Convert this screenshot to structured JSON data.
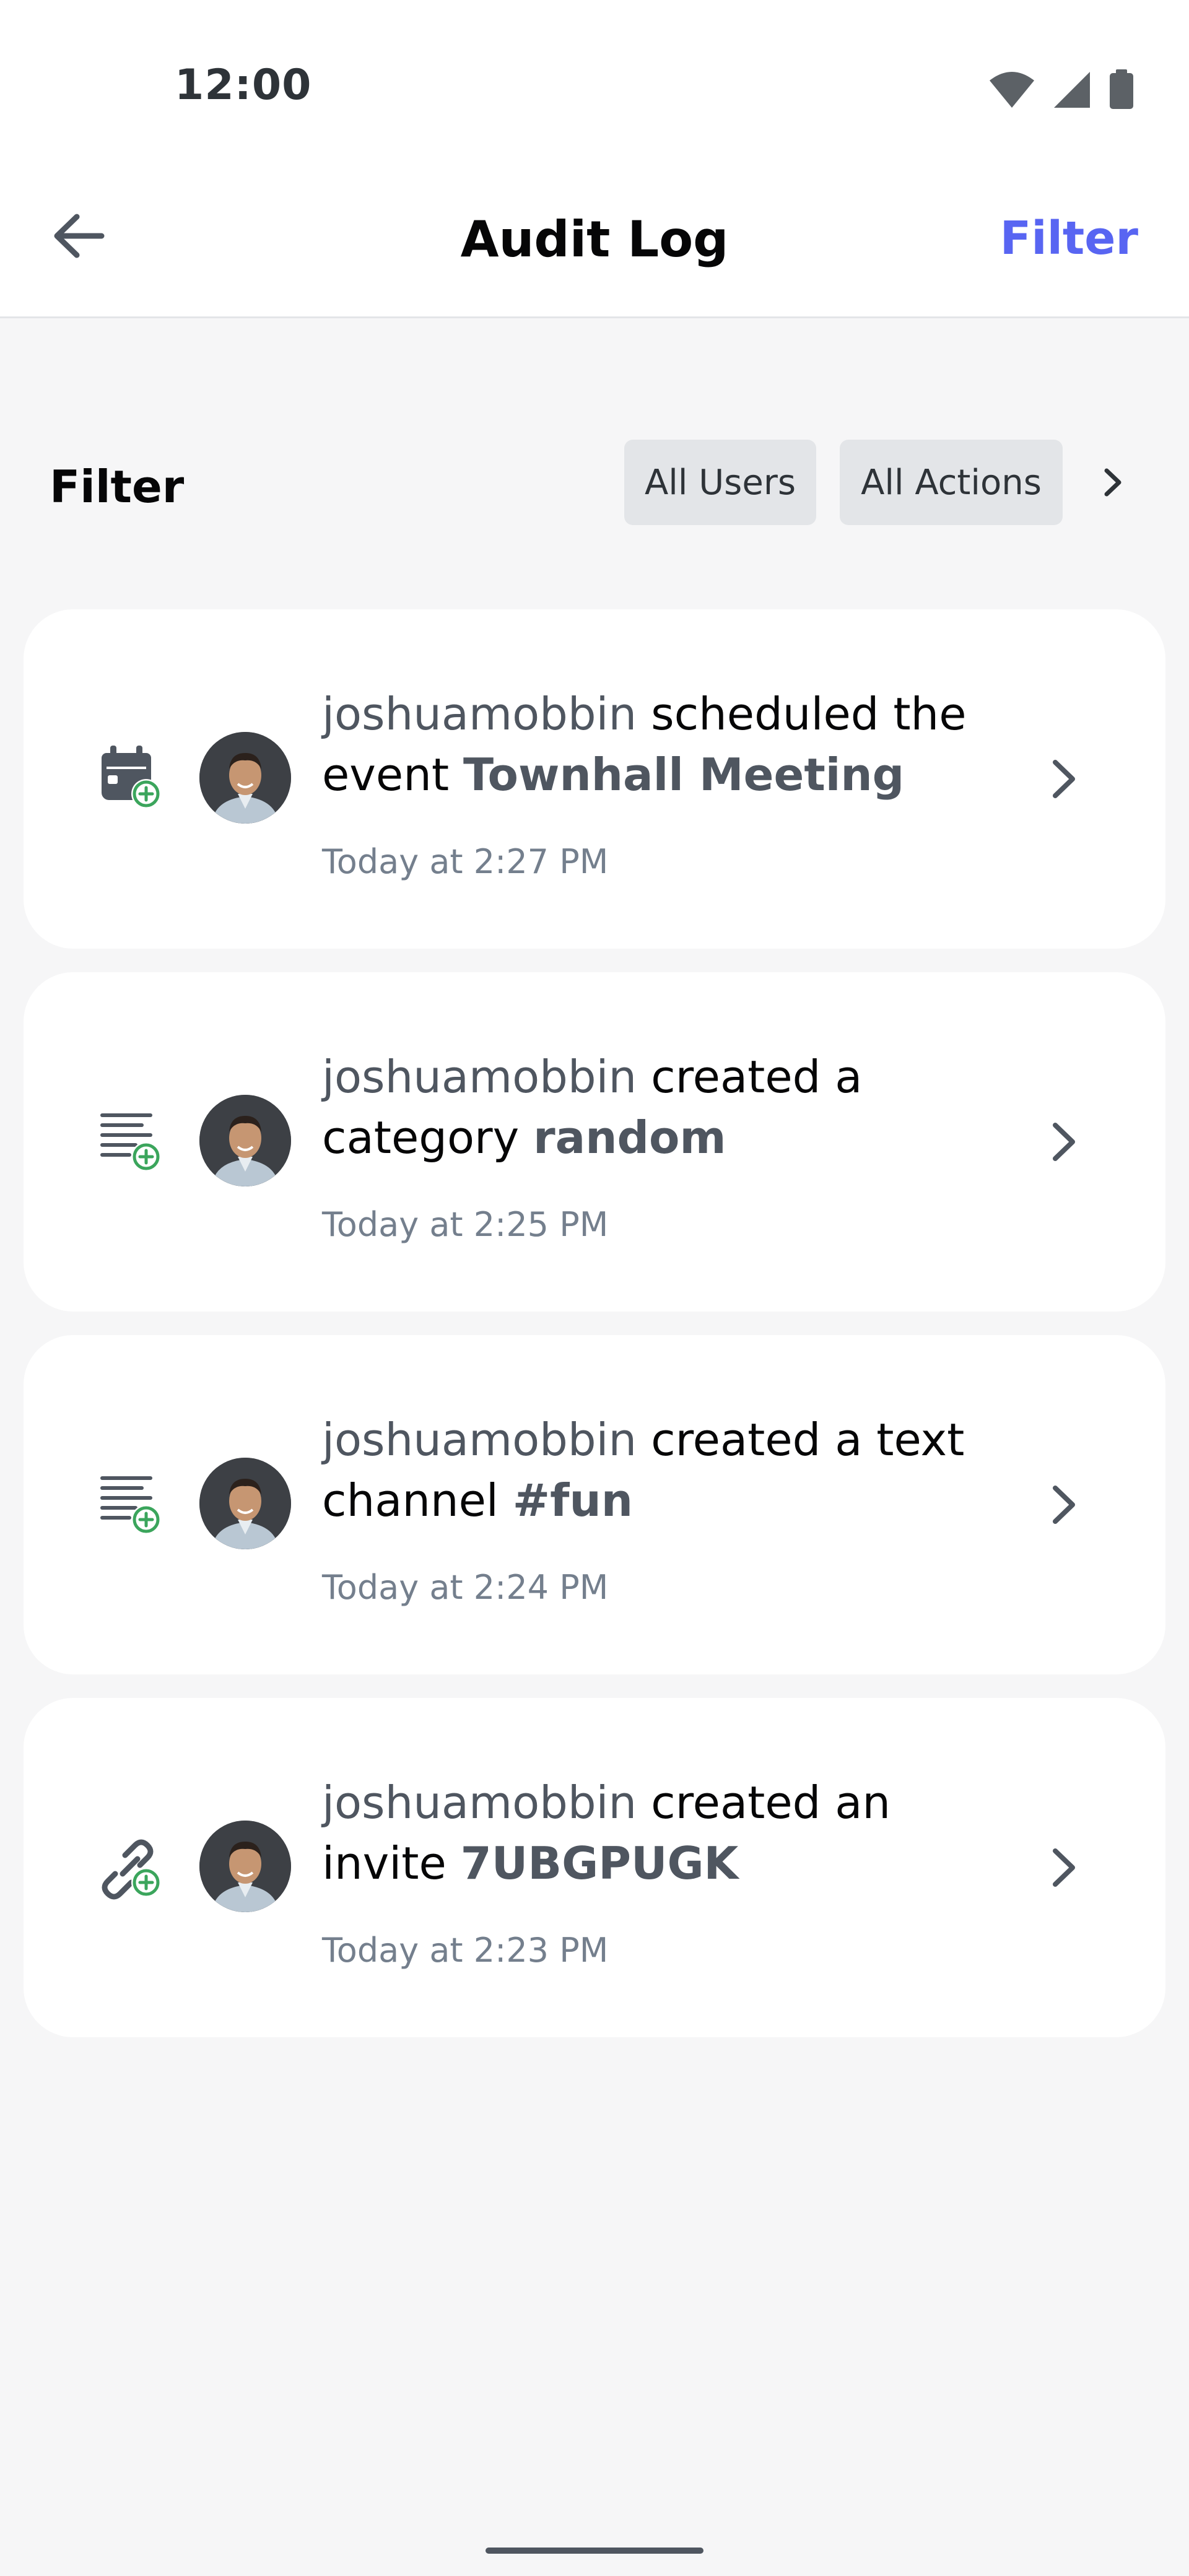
{
  "status_bar": {
    "time": "12:00",
    "icons": [
      "wifi-icon",
      "cellular-signal-icon",
      "battery-icon"
    ]
  },
  "header": {
    "title": "Audit Log",
    "back_icon": "arrow-left-icon",
    "filter_label": "Filter",
    "accent_color": "#5865f2"
  },
  "filter_bar": {
    "label": "Filter",
    "chips": [
      "All Users",
      "All Actions"
    ],
    "more_icon": "chevron-right-icon"
  },
  "entries": [
    {
      "icon": "calendar-add-icon",
      "user": "joshuamobbin",
      "action": " scheduled the event ",
      "target": "Townhall Meeting",
      "time": "Today at 2:27 PM"
    },
    {
      "icon": "category-add-icon",
      "user": "joshuamobbin",
      "action": " created a category ",
      "target": "random",
      "time": "Today at 2:25 PM"
    },
    {
      "icon": "channel-add-icon",
      "user": "joshuamobbin",
      "action": " created a text channel ",
      "target": "#fun",
      "time": "Today at 2:24 PM"
    },
    {
      "icon": "invite-link-add-icon",
      "user": "joshuamobbin",
      "action": " created an invite ",
      "target": "7UBGPUGK",
      "time": "Today at 2:23 PM"
    }
  ]
}
